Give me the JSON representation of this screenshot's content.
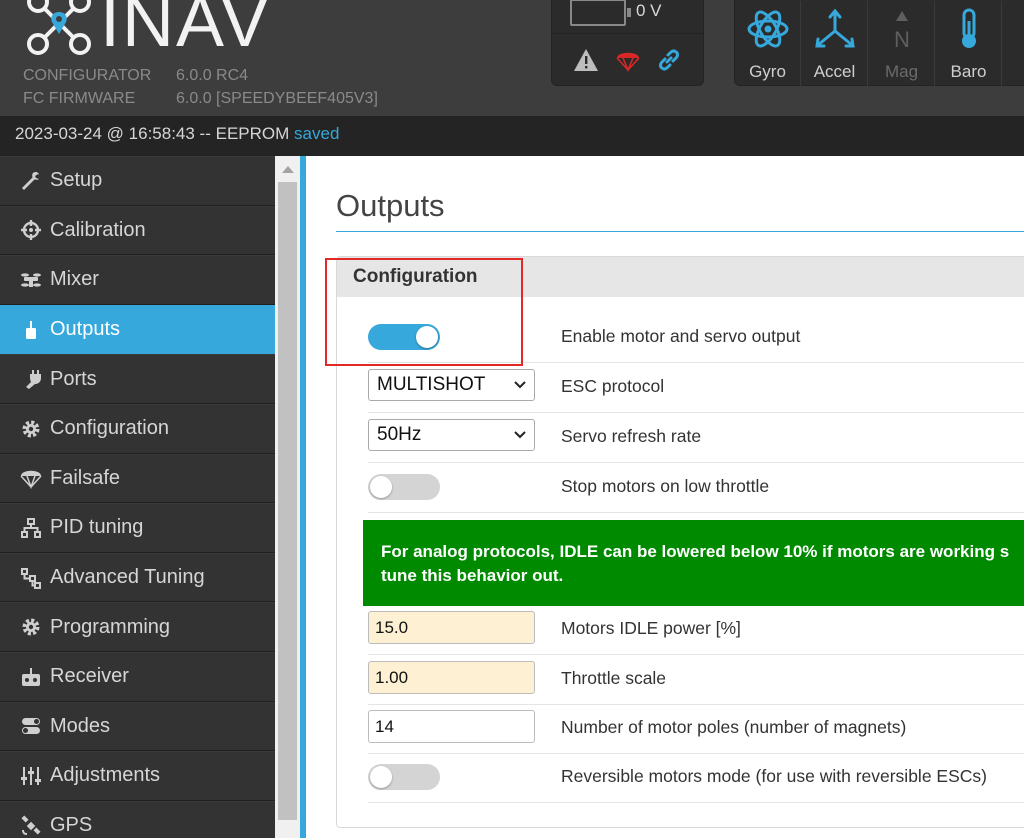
{
  "header": {
    "logo_text": "INAV",
    "configurator_label": "CONFIGURATOR",
    "configurator_version": "6.0.0 RC4",
    "firmware_label": "FC FIRMWARE",
    "firmware_version": "6.0.0 [SPEEDYBEEF405V3]",
    "battery_voltage": "0 V",
    "status_icons": [
      "warning-icon",
      "failsafe-parachute-icon",
      "link-icon"
    ],
    "sensors": [
      {
        "label": "Gyro",
        "icon": "gyro-icon",
        "active": true
      },
      {
        "label": "Accel",
        "icon": "accel-icon",
        "active": true
      },
      {
        "label": "Mag",
        "icon": "mag-icon",
        "active": false
      },
      {
        "label": "Baro",
        "icon": "baro-icon",
        "active": true
      }
    ]
  },
  "statusbar": {
    "text": "2023-03-24 @ 16:58:43 -- EEPROM",
    "state": "saved"
  },
  "sidebar": {
    "items": [
      {
        "label": "Setup",
        "icon": "wrench-icon"
      },
      {
        "label": "Calibration",
        "icon": "crosshair-icon"
      },
      {
        "label": "Mixer",
        "icon": "mixer-icon"
      },
      {
        "label": "Outputs",
        "icon": "motor-icon",
        "active": true
      },
      {
        "label": "Ports",
        "icon": "plug-icon"
      },
      {
        "label": "Configuration",
        "icon": "gear-icon"
      },
      {
        "label": "Failsafe",
        "icon": "parachute-icon"
      },
      {
        "label": "PID tuning",
        "icon": "pid-icon"
      },
      {
        "label": "Advanced Tuning",
        "icon": "tree-icon"
      },
      {
        "label": "Programming",
        "icon": "gear-icon"
      },
      {
        "label": "Receiver",
        "icon": "receiver-icon"
      },
      {
        "label": "Modes",
        "icon": "toggle-icon"
      },
      {
        "label": "Adjustments",
        "icon": "sliders-icon"
      },
      {
        "label": "GPS",
        "icon": "satellite-icon"
      }
    ]
  },
  "main": {
    "page_title": "Outputs",
    "section_title": "Configuration",
    "enable_output_label": "Enable motor and servo output",
    "enable_output_on": true,
    "esc_protocol_value": "MULTISHOT",
    "esc_protocol_label": "ESC protocol",
    "servo_rate_value": "50Hz",
    "servo_rate_label": "Servo refresh rate",
    "stop_motors_label": "Stop motors on low throttle",
    "stop_motors_on": false,
    "alert_line1": "For analog protocols, IDLE can be lowered below 10% if motors are working s",
    "alert_line2": "tune this behavior out.",
    "idle_power_value": "15.0",
    "idle_power_label": "Motors IDLE power [%]",
    "throttle_scale_value": "1.00",
    "throttle_scale_label": "Throttle scale",
    "motor_poles_value": "14",
    "motor_poles_label": "Number of motor poles (number of magnets)",
    "reversible_label": "Reversible motors mode (for use with reversible ESCs)",
    "reversible_on": false
  },
  "colors": {
    "accent": "#37a8db",
    "alert_green": "#008a00",
    "annotation_red": "#e32828"
  }
}
